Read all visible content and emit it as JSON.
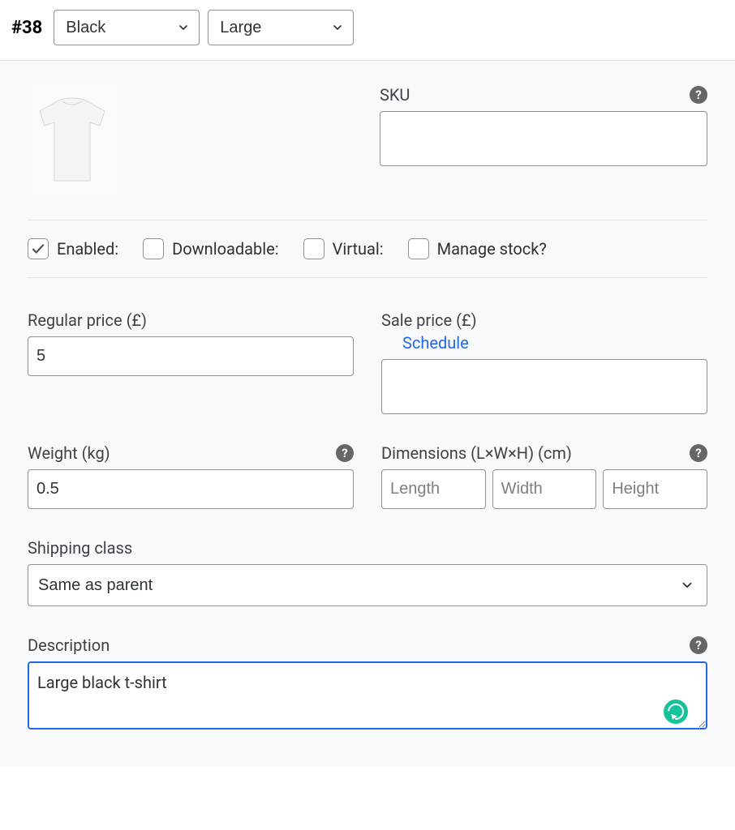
{
  "header": {
    "variation_id": "#38",
    "attribute_color": "Black",
    "attribute_size": "Large"
  },
  "sku": {
    "label": "SKU",
    "value": ""
  },
  "checks": {
    "enabled": {
      "label": "Enabled:",
      "checked": true
    },
    "downloadable": {
      "label": "Downloadable:",
      "checked": false
    },
    "virtual": {
      "label": "Virtual:",
      "checked": false
    },
    "manage_stock": {
      "label": "Manage stock?",
      "checked": false
    }
  },
  "regular_price": {
    "label": "Regular price (£)",
    "value": "5"
  },
  "sale_price": {
    "label": "Sale price (£)",
    "schedule_link": "Schedule",
    "value": ""
  },
  "weight": {
    "label": "Weight (kg)",
    "value": "0.5"
  },
  "dimensions": {
    "label": "Dimensions (L×W×H) (cm)",
    "length_ph": "Length",
    "width_ph": "Width",
    "height_ph": "Height",
    "length": "",
    "width": "",
    "height": ""
  },
  "shipping_class": {
    "label": "Shipping class",
    "value": "Same as parent"
  },
  "description": {
    "label": "Description",
    "value": "Large black t-shirt"
  }
}
